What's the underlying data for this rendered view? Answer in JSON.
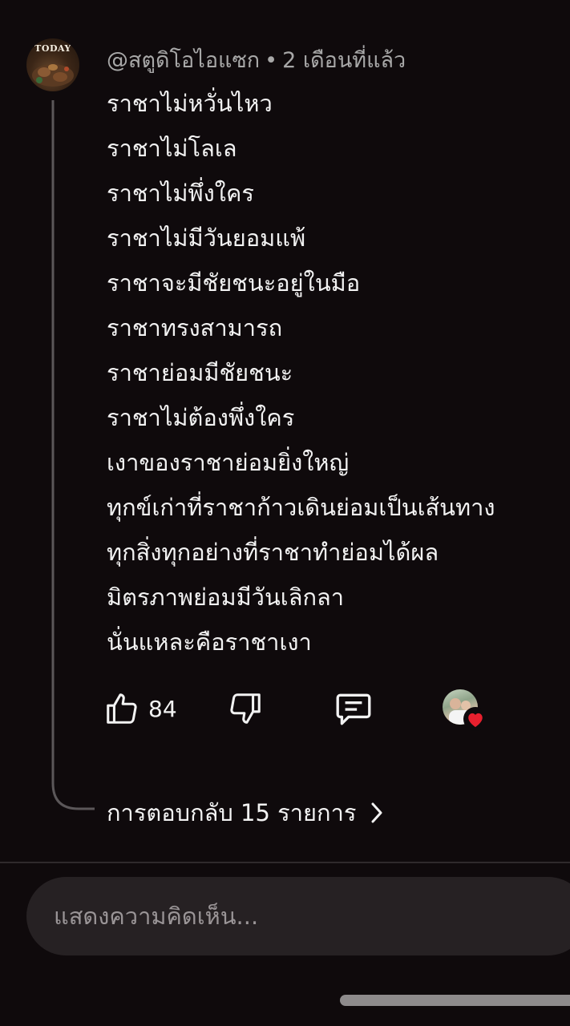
{
  "comment": {
    "avatar_logo": "TODAY",
    "author": "@สตูดิโอไอแซก",
    "separator": "•",
    "time": "2 เดือนที่แล้ว",
    "lines": [
      "ราชาไม่หวั่นไหว",
      "ราชาไม่โลเล",
      "ราชาไม่พึ่งใคร",
      "ราชาไม่มีวันยอมแพ้",
      "ราชาจะมีชัยชนะอยู่ในมือ",
      "ราชาทรงสามารถ",
      "ราชาย่อมมีชัยชนะ",
      "ราชาไม่ต้องพึ่งใคร",
      "เงาของราชาย่อมยิ่งใหญ่",
      "ทุกข์เก่าที่ราชาก้าวเดินย่อมเป็นเส้นทาง",
      "ทุกสิ่งทุกอย่างที่ราชาทำย่อมได้ผล",
      "มิตรภาพย่อมมีวันเลิกลา",
      "นั่นแหละคือราชาเงา"
    ]
  },
  "actions": {
    "like_count": "84",
    "icons": {
      "like": "thumbs-up-icon",
      "dislike": "thumbs-down-icon",
      "reply": "comment-icon",
      "creator_heart": "heart-icon"
    },
    "heart_color": "#e8202e"
  },
  "replies": {
    "label": "การตอบกลับ 15 รายการ"
  },
  "input": {
    "placeholder": "แสดงความคิดเห็น..."
  },
  "colors": {
    "background": "#0f0a0c",
    "secondary_text": "#a8a8a8",
    "input_background": "#262123"
  }
}
